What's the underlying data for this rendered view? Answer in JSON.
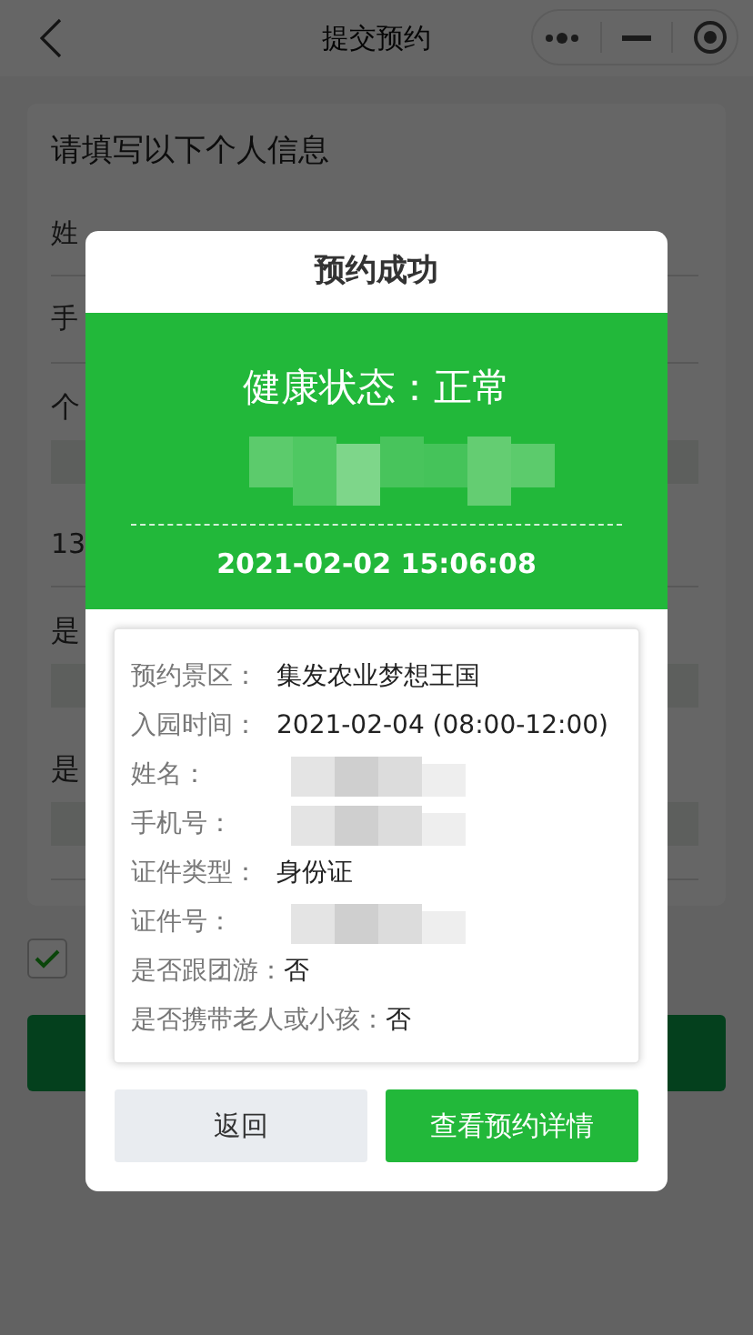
{
  "nav": {
    "title": "提交预约"
  },
  "background_form": {
    "heading": "请填写以下个人信息",
    "items": [
      {
        "kind": "row",
        "text": "姓"
      },
      {
        "kind": "row",
        "text": "手"
      },
      {
        "kind": "label",
        "text": "个"
      },
      {
        "kind": "box"
      },
      {
        "kind": "row",
        "text": "13"
      },
      {
        "kind": "label",
        "text": "是"
      },
      {
        "kind": "box"
      },
      {
        "kind": "label",
        "text": "是"
      },
      {
        "kind": "box"
      }
    ],
    "agree_checkbox": {
      "checked": true
    }
  },
  "modal": {
    "title": "预约成功",
    "status": "健康状态：正常",
    "time": "2021-02-02 15:06:08",
    "details": [
      {
        "label": "预约景区：",
        "value": "集发农业梦想王国"
      },
      {
        "label": "入园时间：",
        "value": "2021-02-04 (08:00-12:00)"
      },
      {
        "label": "姓名：",
        "redacted": true
      },
      {
        "label": "手机号：",
        "redacted": true
      },
      {
        "label": "证件类型：",
        "value": "身份证"
      },
      {
        "label": "证件号：",
        "redacted": true
      },
      {
        "label": "是否跟团游：",
        "value": "否",
        "inline": true
      },
      {
        "label": "是否携带老人或小孩：",
        "value": "否",
        "inline": true
      }
    ],
    "buttons": [
      {
        "kind": "secondary",
        "label": "返回"
      },
      {
        "kind": "primary",
        "label": "查看预约详情"
      }
    ]
  }
}
